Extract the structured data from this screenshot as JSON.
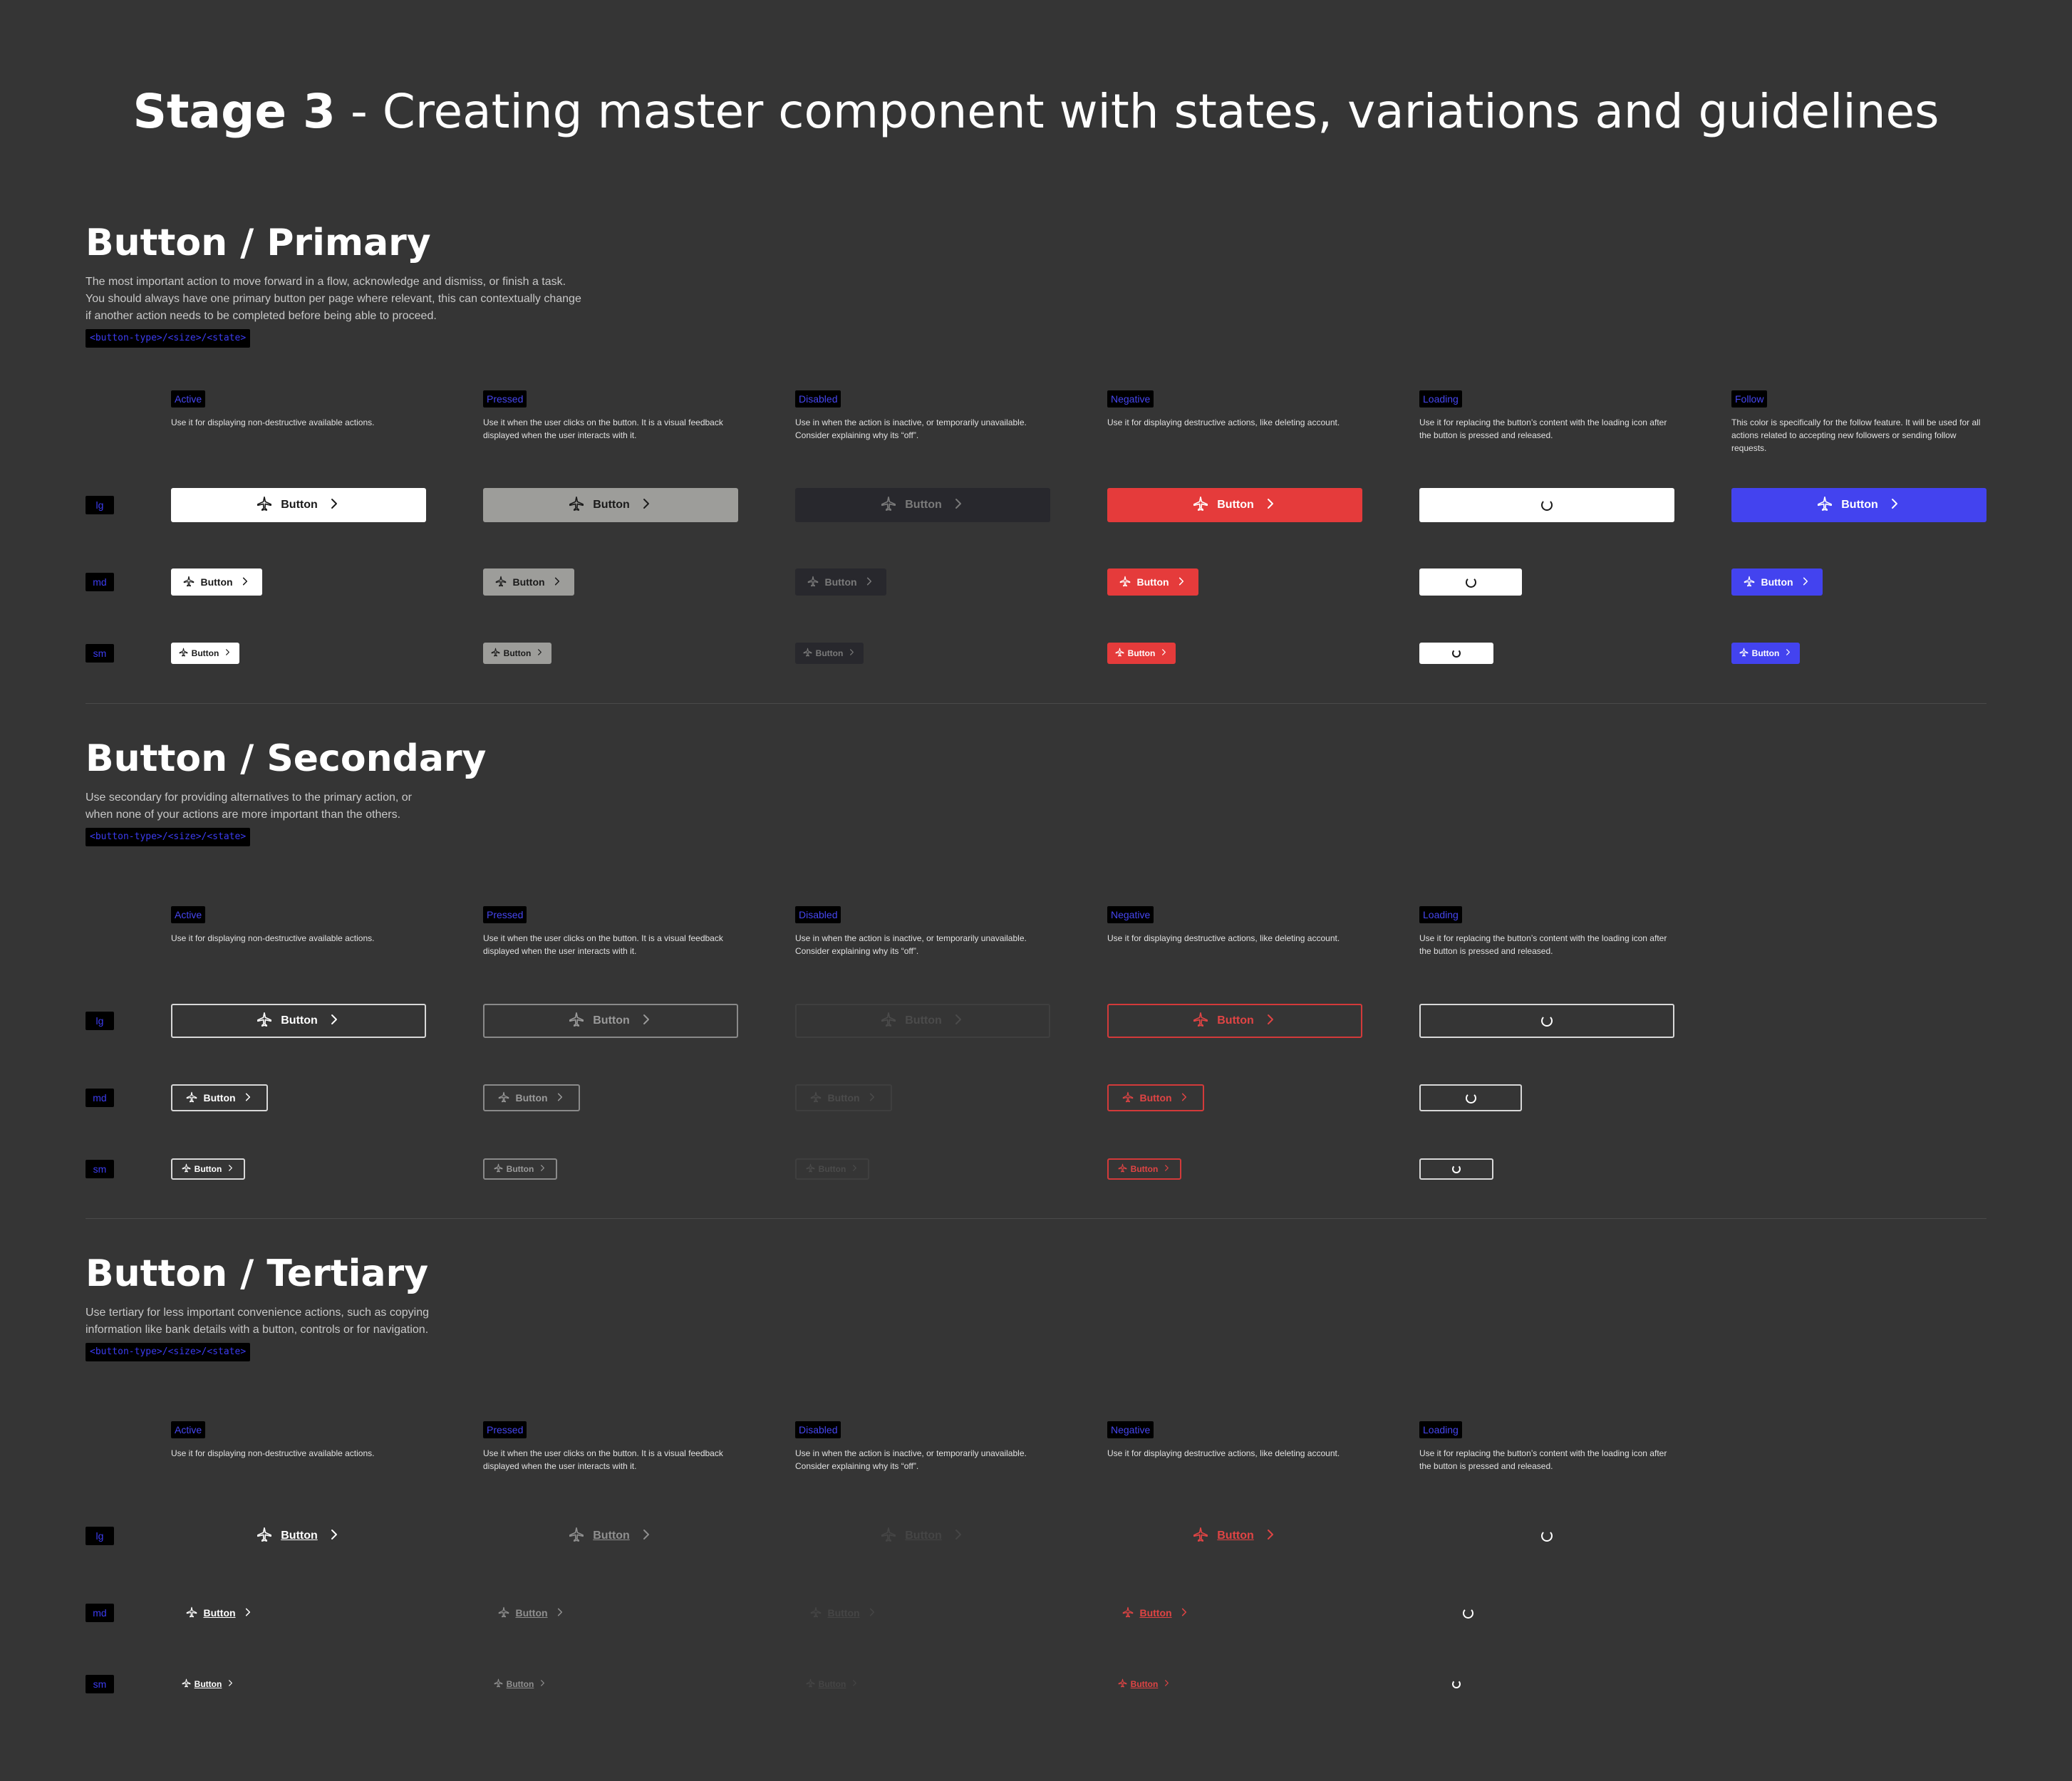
{
  "page": {
    "title_bold": "Stage 3",
    "title_rest": " - Creating master component with states, variations and guidelines"
  },
  "sections": [
    {
      "title": "Button / Primary",
      "description": "The most important action to move forward in a flow, acknowledge and dismiss, or finish a task.\nYou should always have one primary button per page where relevant, this can contextually change\nif another action needs to be completed before being able to proceed.",
      "pattern": "<button-type>/<size>/<state>",
      "states": [
        {
          "label": "Active",
          "desc": "Use it for displaying non-destructive available actions."
        },
        {
          "label": "Pressed",
          "desc": "Use it when the user clicks on the button. It is a visual feedback displayed when the user interacts with it."
        },
        {
          "label": "Disabled",
          "desc": "Use in when the action is inactive, or temporarily unavailable. Consider explaining why its “off”."
        },
        {
          "label": "Negative",
          "desc": "Use it for displaying destructive actions, like deleting account."
        },
        {
          "label": "Loading",
          "desc": "Use it for replacing the button’s content with the loading icon after the button is pressed and released."
        },
        {
          "label": "Follow",
          "desc": "This color is specifically for the follow feature. It will be used for all actions related to accepting new followers or sending follow requests."
        }
      ]
    },
    {
      "title": "Button / Secondary",
      "description": "Use secondary for providing alternatives to the primary action, or\nwhen none of your actions are more important than the others.",
      "pattern": "<button-type>/<size>/<state>",
      "states": [
        {
          "label": "Active",
          "desc": "Use it for displaying non-destructive available actions."
        },
        {
          "label": "Pressed",
          "desc": "Use it when the user clicks on the button. It is a visual feedback displayed when the user interacts with it."
        },
        {
          "label": "Disabled",
          "desc": "Use in when the action is inactive, or temporarily unavailable. Consider explaining why its “off”."
        },
        {
          "label": "Negative",
          "desc": "Use it for displaying destructive actions, like deleting account."
        },
        {
          "label": "Loading",
          "desc": "Use it for replacing the button’s content with the loading icon after the button is pressed and released."
        }
      ]
    },
    {
      "title": "Button / Tertiary",
      "description": "Use tertiary for less important convenience actions, such as copying\ninformation like bank details with a button, controls or for navigation.",
      "pattern": "<button-type>/<size>/<state>",
      "states": [
        {
          "label": "Active",
          "desc": "Use it for displaying non-destructive available actions."
        },
        {
          "label": "Pressed",
          "desc": "Use it when the user clicks on the button. It is a visual feedback displayed when the user interacts with it."
        },
        {
          "label": "Disabled",
          "desc": "Use in when the action is inactive, or temporarily unavailable. Consider explaining why its “off”."
        },
        {
          "label": "Negative",
          "desc": "Use it for displaying destructive actions, like deleting account."
        },
        {
          "label": "Loading",
          "desc": "Use it for replacing the button’s content with the loading icon after the button is pressed and released."
        }
      ]
    }
  ],
  "sizes": [
    "lg",
    "md",
    "sm"
  ],
  "button_label": "Button",
  "colors": {
    "background": "#353535",
    "tag_text": "#3c3cf0",
    "negative": "#e53b3b",
    "follow": "#4343ef"
  },
  "icons": {
    "leading": "plane-icon",
    "trailing": "chevron-right-icon",
    "loading": "spinner-icon"
  }
}
